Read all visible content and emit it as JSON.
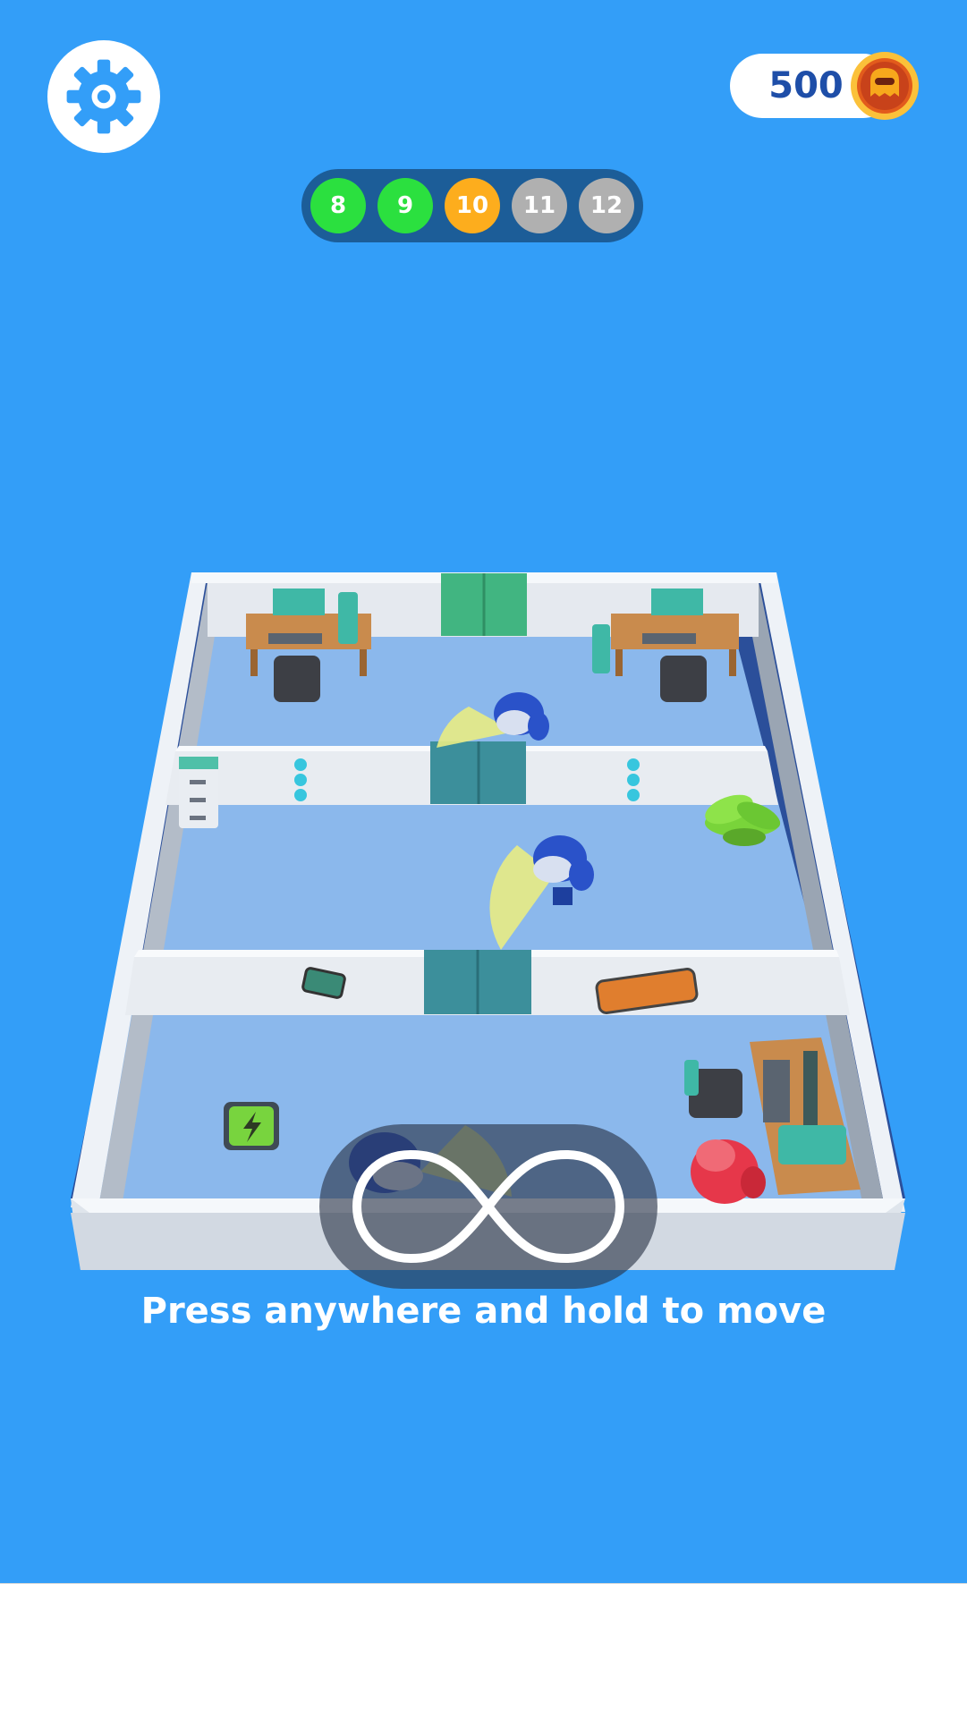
{
  "hud": {
    "coins": "500",
    "levels": [
      {
        "number": "8",
        "state": "done"
      },
      {
        "number": "9",
        "state": "done"
      },
      {
        "number": "10",
        "state": "current"
      },
      {
        "number": "11",
        "state": "locked"
      },
      {
        "number": "12",
        "state": "locked"
      }
    ]
  },
  "hint": {
    "text": "Press anywhere and hold to move",
    "icon": "infinity-gesture-icon"
  },
  "icons": {
    "settings": "gear-icon",
    "coin": "coin-icon",
    "power_pad": "lightning-icon"
  },
  "colors": {
    "background": "#339ef8",
    "level_done": "#2be03f",
    "level_current": "#fdad1d",
    "level_locked": "#b0b0b0",
    "coin_text": "#1e4ea8",
    "guard": "#2a52c9",
    "player": "#e6374a",
    "vision_cone": "#e8ec84"
  }
}
